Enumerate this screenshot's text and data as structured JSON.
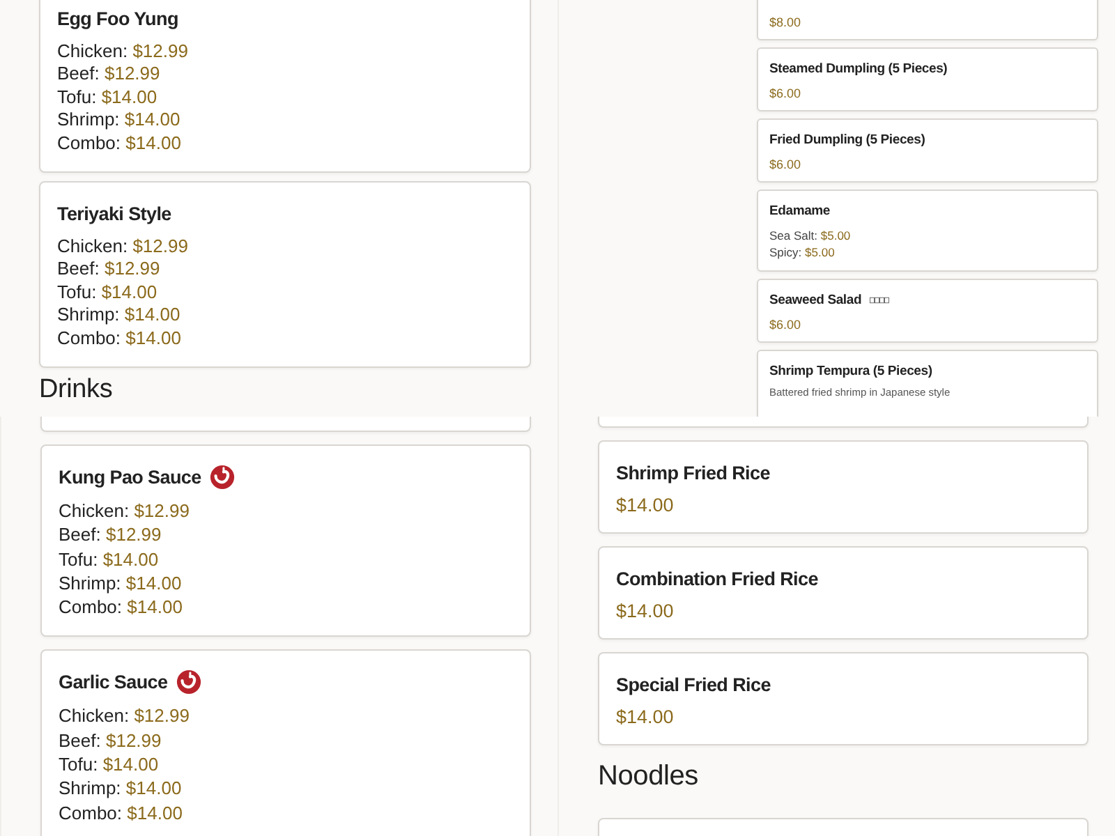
{
  "panels": [
    {
      "kind": "regular",
      "items": [
        {
          "kind": "card",
          "title": "Egg Foo Yung",
          "spicy": false,
          "options": [
            {
              "label": "Chicken:",
              "price": "$12.99"
            },
            {
              "label": "Beef:",
              "price": "$12.99"
            },
            {
              "label": "Tofu:",
              "price": "$14.00"
            },
            {
              "label": "Shrimp:",
              "price": "$14.00"
            },
            {
              "label": "Combo:",
              "price": "$14.00"
            }
          ]
        },
        {
          "kind": "card",
          "title": "Teriyaki Style",
          "spicy": false,
          "options": [
            {
              "label": "Chicken:",
              "price": "$12.99"
            },
            {
              "label": "Beef:",
              "price": "$12.99"
            },
            {
              "label": "Tofu:",
              "price": "$14.00"
            },
            {
              "label": "Shrimp:",
              "price": "$14.00"
            },
            {
              "label": "Combo:",
              "price": "$14.00"
            }
          ]
        },
        {
          "kind": "heading",
          "title": "Drinks"
        }
      ]
    },
    {
      "kind": "compact",
      "items": [
        {
          "kind": "card",
          "price": "$8.00"
        },
        {
          "kind": "card",
          "title": "Steamed Dumpling (5 Pieces)",
          "price": "$6.00"
        },
        {
          "kind": "card",
          "title": "Fried Dumpling (5 Pieces)",
          "price": "$6.00"
        },
        {
          "kind": "card",
          "title": "Edamame",
          "options": [
            {
              "label": "Sea Salt:",
              "price": "$5.00"
            },
            {
              "label": "Spicy:",
              "price": "$5.00"
            }
          ]
        },
        {
          "kind": "card",
          "title": "Seaweed Salad",
          "missing_glyphs": true,
          "price": "$6.00"
        },
        {
          "kind": "card",
          "title": "Shrimp Tempura (5 Pieces)",
          "description": "Battered fried shrimp in Japanese style"
        }
      ]
    },
    {
      "kind": "regular",
      "items": [
        {
          "kind": "clipped_card"
        },
        {
          "kind": "card",
          "title": "Kung Pao Sauce",
          "spicy": true,
          "options": [
            {
              "label": "Chicken:",
              "price": "$12.99"
            },
            {
              "label": "Beef:",
              "price": "$12.99"
            },
            {
              "label": "Tofu:",
              "price": "$14.00"
            },
            {
              "label": "Shrimp:",
              "price": "$14.00"
            },
            {
              "label": "Combo:",
              "price": "$14.00"
            }
          ]
        },
        {
          "kind": "card",
          "title": "Garlic Sauce",
          "spicy": true,
          "options": [
            {
              "label": "Chicken:",
              "price": "$12.99"
            },
            {
              "label": "Beef:",
              "price": "$12.99"
            },
            {
              "label": "Tofu:",
              "price": "$14.00"
            },
            {
              "label": "Shrimp:",
              "price": "$14.00"
            },
            {
              "label": "Combo:",
              "price": "$14.00"
            }
          ]
        }
      ]
    },
    {
      "kind": "regular",
      "items": [
        {
          "kind": "clipped_card"
        },
        {
          "kind": "card",
          "title": "Shrimp Fried Rice",
          "price": "$14.00"
        },
        {
          "kind": "card",
          "title": "Combination Fried Rice",
          "price": "$14.00"
        },
        {
          "kind": "card",
          "title": "Special Fried Rice",
          "price": "$14.00"
        },
        {
          "kind": "heading",
          "title": "Noodles"
        },
        {
          "kind": "clipped_card"
        }
      ]
    }
  ]
}
